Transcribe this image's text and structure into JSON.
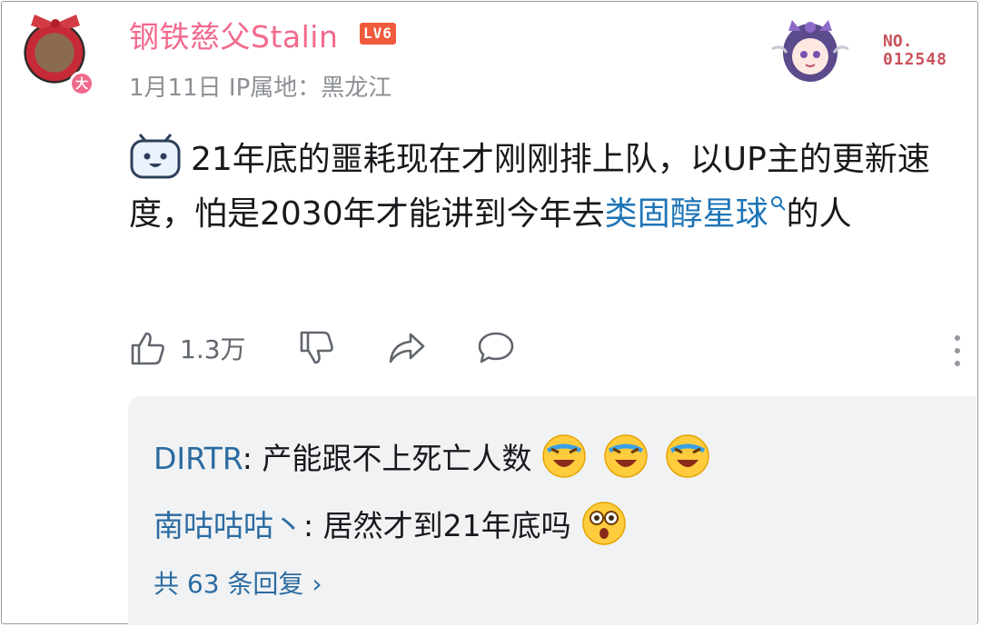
{
  "comment": {
    "username": "钢铁慈父Stalin",
    "level": "LV6",
    "date": "1月11日",
    "ip_location": "IP属地：黑龙江",
    "avatar_badge": "大",
    "fan_label": "NO.",
    "fan_number": "012548",
    "text_before": "21年底的噩耗现在才刚刚排上队，以UP主的更新速度，怕是2030年才能讲到今年去",
    "keyword": "类固醇星球",
    "text_after": "的人",
    "likes": "1.3万",
    "colors": {
      "username": "#f26a8d",
      "link": "#1d74b6",
      "level_bg": "#f05a3c"
    }
  },
  "replies": {
    "items": [
      {
        "user": "DIRTR",
        "text": ": 产能跟不上死亡人数",
        "emoji": [
          "crying-laughing-emoji",
          "crying-laughing-emoji",
          "crying-laughing-emoji"
        ]
      },
      {
        "user": "南咕咕咕丶",
        "text": ": 居然才到21年底吗",
        "emoji": [
          "shocked-emoji"
        ]
      }
    ],
    "more": "共 63 条回复 ›"
  }
}
